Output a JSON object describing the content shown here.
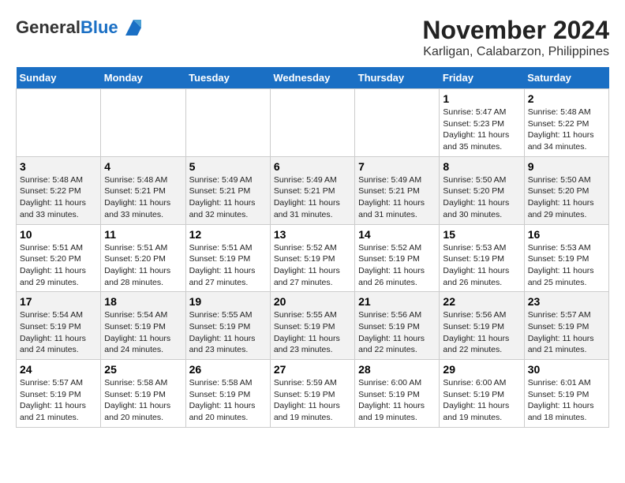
{
  "logo": {
    "general": "General",
    "blue": "Blue"
  },
  "title": "November 2024",
  "subtitle": "Karligan, Calabarzon, Philippines",
  "headers": [
    "Sunday",
    "Monday",
    "Tuesday",
    "Wednesday",
    "Thursday",
    "Friday",
    "Saturday"
  ],
  "weeks": [
    [
      {
        "day": "",
        "info": ""
      },
      {
        "day": "",
        "info": ""
      },
      {
        "day": "",
        "info": ""
      },
      {
        "day": "",
        "info": ""
      },
      {
        "day": "",
        "info": ""
      },
      {
        "day": "1",
        "info": "Sunrise: 5:47 AM\nSunset: 5:23 PM\nDaylight: 11 hours and 35 minutes."
      },
      {
        "day": "2",
        "info": "Sunrise: 5:48 AM\nSunset: 5:22 PM\nDaylight: 11 hours and 34 minutes."
      }
    ],
    [
      {
        "day": "3",
        "info": "Sunrise: 5:48 AM\nSunset: 5:22 PM\nDaylight: 11 hours and 33 minutes."
      },
      {
        "day": "4",
        "info": "Sunrise: 5:48 AM\nSunset: 5:21 PM\nDaylight: 11 hours and 33 minutes."
      },
      {
        "day": "5",
        "info": "Sunrise: 5:49 AM\nSunset: 5:21 PM\nDaylight: 11 hours and 32 minutes."
      },
      {
        "day": "6",
        "info": "Sunrise: 5:49 AM\nSunset: 5:21 PM\nDaylight: 11 hours and 31 minutes."
      },
      {
        "day": "7",
        "info": "Sunrise: 5:49 AM\nSunset: 5:21 PM\nDaylight: 11 hours and 31 minutes."
      },
      {
        "day": "8",
        "info": "Sunrise: 5:50 AM\nSunset: 5:20 PM\nDaylight: 11 hours and 30 minutes."
      },
      {
        "day": "9",
        "info": "Sunrise: 5:50 AM\nSunset: 5:20 PM\nDaylight: 11 hours and 29 minutes."
      }
    ],
    [
      {
        "day": "10",
        "info": "Sunrise: 5:51 AM\nSunset: 5:20 PM\nDaylight: 11 hours and 29 minutes."
      },
      {
        "day": "11",
        "info": "Sunrise: 5:51 AM\nSunset: 5:20 PM\nDaylight: 11 hours and 28 minutes."
      },
      {
        "day": "12",
        "info": "Sunrise: 5:51 AM\nSunset: 5:19 PM\nDaylight: 11 hours and 27 minutes."
      },
      {
        "day": "13",
        "info": "Sunrise: 5:52 AM\nSunset: 5:19 PM\nDaylight: 11 hours and 27 minutes."
      },
      {
        "day": "14",
        "info": "Sunrise: 5:52 AM\nSunset: 5:19 PM\nDaylight: 11 hours and 26 minutes."
      },
      {
        "day": "15",
        "info": "Sunrise: 5:53 AM\nSunset: 5:19 PM\nDaylight: 11 hours and 26 minutes."
      },
      {
        "day": "16",
        "info": "Sunrise: 5:53 AM\nSunset: 5:19 PM\nDaylight: 11 hours and 25 minutes."
      }
    ],
    [
      {
        "day": "17",
        "info": "Sunrise: 5:54 AM\nSunset: 5:19 PM\nDaylight: 11 hours and 24 minutes."
      },
      {
        "day": "18",
        "info": "Sunrise: 5:54 AM\nSunset: 5:19 PM\nDaylight: 11 hours and 24 minutes."
      },
      {
        "day": "19",
        "info": "Sunrise: 5:55 AM\nSunset: 5:19 PM\nDaylight: 11 hours and 23 minutes."
      },
      {
        "day": "20",
        "info": "Sunrise: 5:55 AM\nSunset: 5:19 PM\nDaylight: 11 hours and 23 minutes."
      },
      {
        "day": "21",
        "info": "Sunrise: 5:56 AM\nSunset: 5:19 PM\nDaylight: 11 hours and 22 minutes."
      },
      {
        "day": "22",
        "info": "Sunrise: 5:56 AM\nSunset: 5:19 PM\nDaylight: 11 hours and 22 minutes."
      },
      {
        "day": "23",
        "info": "Sunrise: 5:57 AM\nSunset: 5:19 PM\nDaylight: 11 hours and 21 minutes."
      }
    ],
    [
      {
        "day": "24",
        "info": "Sunrise: 5:57 AM\nSunset: 5:19 PM\nDaylight: 11 hours and 21 minutes."
      },
      {
        "day": "25",
        "info": "Sunrise: 5:58 AM\nSunset: 5:19 PM\nDaylight: 11 hours and 20 minutes."
      },
      {
        "day": "26",
        "info": "Sunrise: 5:58 AM\nSunset: 5:19 PM\nDaylight: 11 hours and 20 minutes."
      },
      {
        "day": "27",
        "info": "Sunrise: 5:59 AM\nSunset: 5:19 PM\nDaylight: 11 hours and 19 minutes."
      },
      {
        "day": "28",
        "info": "Sunrise: 6:00 AM\nSunset: 5:19 PM\nDaylight: 11 hours and 19 minutes."
      },
      {
        "day": "29",
        "info": "Sunrise: 6:00 AM\nSunset: 5:19 PM\nDaylight: 11 hours and 19 minutes."
      },
      {
        "day": "30",
        "info": "Sunrise: 6:01 AM\nSunset: 5:19 PM\nDaylight: 11 hours and 18 minutes."
      }
    ]
  ]
}
